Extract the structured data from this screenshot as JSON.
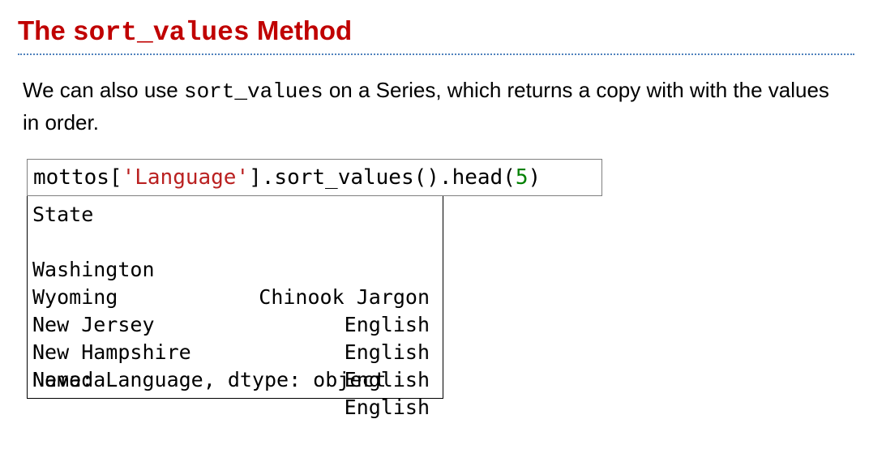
{
  "title": {
    "prefix": "The ",
    "code": "sort_values",
    "suffix": " Method"
  },
  "paragraph": {
    "before": "We can also use ",
    "code": "sort_values",
    "after": " on a Series, which returns a copy with with the values in order."
  },
  "code_cell": {
    "part1": "mottos[",
    "string": "'Language'",
    "part2": "].sort_values().head(",
    "number": "5",
    "part3": ")"
  },
  "output": {
    "index_name": "State",
    "rows": [
      {
        "index": "Washington",
        "value": "Chinook Jargon"
      },
      {
        "index": "Wyoming",
        "value": "English"
      },
      {
        "index": "New Jersey",
        "value": "English"
      },
      {
        "index": "New Hampshire",
        "value": "English"
      },
      {
        "index": "Nevada",
        "value": "English"
      }
    ],
    "footer": "Name: Language, dtype: object"
  },
  "colors": {
    "title": "#c00000",
    "divider": "#4f81bd",
    "string": "#ba2121",
    "number": "#008000"
  }
}
